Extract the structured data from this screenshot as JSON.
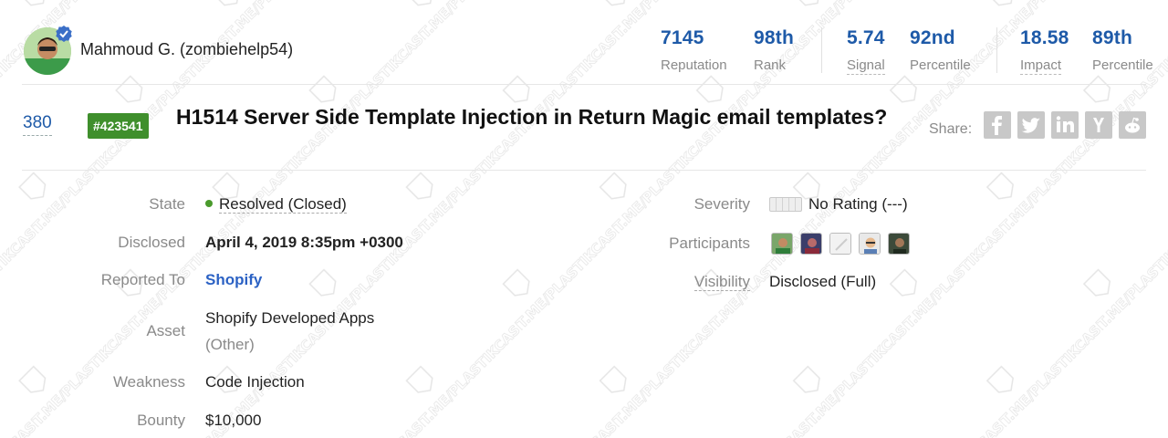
{
  "header": {
    "username": "Mahmoud G. (zombiehelp54)",
    "stats": [
      {
        "value": "7145",
        "label": "Reputation"
      },
      {
        "value": "98th",
        "label": "Rank"
      },
      {
        "value": "5.74",
        "label": "Signal"
      },
      {
        "value": "92nd",
        "label": "Percentile"
      },
      {
        "value": "18.58",
        "label": "Impact"
      },
      {
        "value": "89th",
        "label": "Percentile"
      }
    ]
  },
  "report": {
    "votes": "380",
    "id_badge": "#423541",
    "title": "H1514 Server Side Template Injection in Return Magic email templates?",
    "share_label": "Share:"
  },
  "details_left": {
    "state_label": "State",
    "state_value": "Resolved (Closed)",
    "disclosed_label": "Disclosed",
    "disclosed_value": "April 4, 2019 8:35pm +0300",
    "reported_to_label": "Reported To",
    "reported_to_value": "Shopify",
    "asset_label": "Asset",
    "asset_value": "Shopify Developed Apps",
    "asset_sub": "(Other)",
    "weakness_label": "Weakness",
    "weakness_value": "Code Injection",
    "bounty_label": "Bounty",
    "bounty_value": "$10,000"
  },
  "details_right": {
    "severity_label": "Severity",
    "severity_value": "No Rating (---)",
    "participants_label": "Participants",
    "visibility_label": "Visibility",
    "visibility_value": "Disclosed (Full)"
  },
  "watermark_text": "T.ME/PLASTIKCASH",
  "colors": {
    "link_blue": "#1e5aa8",
    "badge_green": "#3f8f2c",
    "status_green": "#4a9a2c",
    "muted_gray": "#8a8a8a"
  }
}
